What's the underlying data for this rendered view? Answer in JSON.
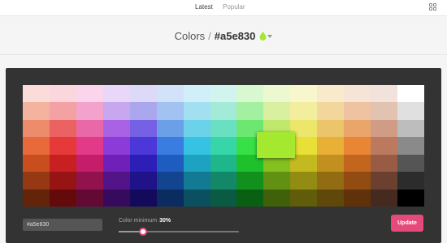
{
  "nav": {
    "tabs": [
      {
        "label": "Latest",
        "active": true
      },
      {
        "label": "Popular",
        "active": false
      }
    ],
    "grid_icon": "grid-icon"
  },
  "header": {
    "section": "Colors",
    "separator": "/",
    "hex": "#a5e830",
    "drop_icon": "color-drop-icon",
    "drop_color": "#a5e830"
  },
  "palette": {
    "selected_color": "#a5e830",
    "rows": [
      [
        "#fcdcd8",
        "#fbd6dc",
        "#fbd5ec",
        "#e8d7f8",
        "#dcdaf8",
        "#d2e2f9",
        "#d0eff8",
        "#d1f5ee",
        "#d8f8d2",
        "#ecf8cf",
        "#f8f6cb",
        "#f8ebcb",
        "#f6e4d6",
        "#f1e3db",
        "#ffffff"
      ],
      [
        "#f4b39f",
        "#f3a1a3",
        "#f2a2cc",
        "#c7a7ee",
        "#aaa7ef",
        "#a2c2f1",
        "#a2e0f1",
        "#a3ead9",
        "#a2f0a0",
        "#d8f0a0",
        "#f2ee9e",
        "#f2d79d",
        "#efc2a2",
        "#e2c3b2",
        "#e0e0e0"
      ],
      [
        "#ec8c6c",
        "#ea6262",
        "#e868a8",
        "#aa62e4",
        "#7660e4",
        "#6ba0e9",
        "#6bd2e9",
        "#6ae0c2",
        "#6ce872",
        "#c0e86a",
        "#ece66a",
        "#ecc46a",
        "#eaa56a",
        "#d09c86",
        "#bdbdbd"
      ],
      [
        "#e86a3a",
        "#e63a3a",
        "#e23a88",
        "#8c3ad8",
        "#4c38d8",
        "#3a7ce0",
        "#36c2e2",
        "#36d6a8",
        "#36e046",
        "#a5e830",
        "#e8e036",
        "#e8b036",
        "#e88636",
        "#bb7a60",
        "#8a8a8a"
      ],
      [
        "#c84e1f",
        "#c82020",
        "#c41e6a",
        "#6e20b8",
        "#2e1eb8",
        "#1e5cc0",
        "#1ea2c2",
        "#1eb68a",
        "#1ec02c",
        "#84c01e",
        "#c2ba1e",
        "#c2901e",
        "#c2661e",
        "#985c44",
        "#555555"
      ],
      [
        "#963814",
        "#961414",
        "#92124e",
        "#521488",
        "#201288",
        "#124490",
        "#127a92",
        "#128868",
        "#12901e",
        "#629012",
        "#928c12",
        "#926c12",
        "#924c12",
        "#6c4030",
        "#2c2c2c"
      ],
      [
        "#64240a",
        "#640a0a",
        "#620a34",
        "#360a5c",
        "#140a5c",
        "#0a2c60",
        "#0a5060",
        "#0a5a44",
        "#0a6012",
        "#40600a",
        "#605c0a",
        "#60480a",
        "#60320a",
        "#462a20",
        "#000000"
      ]
    ]
  },
  "controls": {
    "hex_value": "#a5e830",
    "color_minimum_label": "Color minimum",
    "color_minimum_value": "30%",
    "color_minimum_fraction": 0.3,
    "update_label": "Update",
    "accent": "#e64a7a"
  }
}
